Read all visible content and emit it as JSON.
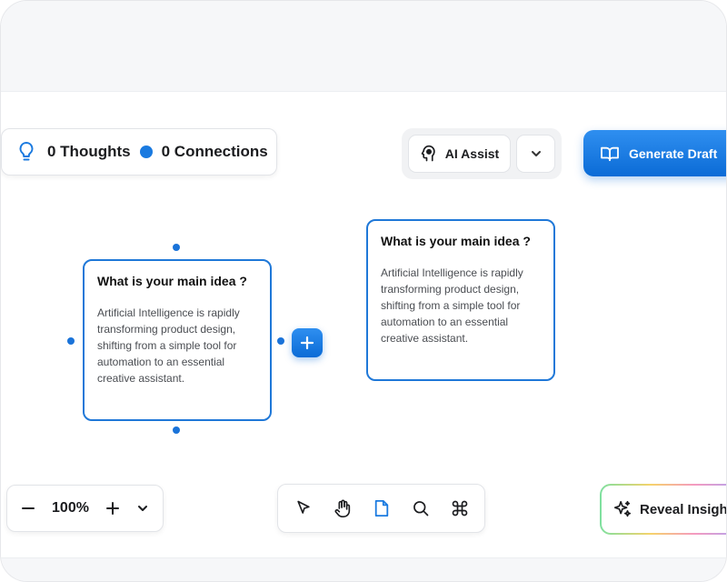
{
  "stats": {
    "thoughts": "0 Thoughts",
    "connections": "0 Connections"
  },
  "toolbar": {
    "ai_assist_label": "AI Assist",
    "generate_label": "Generate Draft"
  },
  "cards": [
    {
      "title": "What is your main idea ?",
      "body": "Artificial Intelligence is rapidly transforming product design, shifting from a simple tool for automation to an essential creative assistant."
    },
    {
      "title": "What is your main idea ?",
      "body": "Artificial Intelligence is rapidly transforming product design, shifting from a simple tool for automation to an essential creative assistant."
    }
  ],
  "zoom": {
    "level": "100%"
  },
  "reveal": {
    "label": "Reveal Insights"
  },
  "icons": {
    "thoughts": "lightbulb-icon",
    "connections": "dot-icon",
    "ai": "head-icon",
    "generate": "book-open-icon",
    "tools": [
      "cursor-icon",
      "hand-icon",
      "document-icon",
      "search-icon",
      "command-icon"
    ],
    "reveal": "sparkles-icon"
  },
  "colors": {
    "accent": "#1a7ae0",
    "card_border": "#1f78d8",
    "active_tool": "#1a7ae0"
  }
}
